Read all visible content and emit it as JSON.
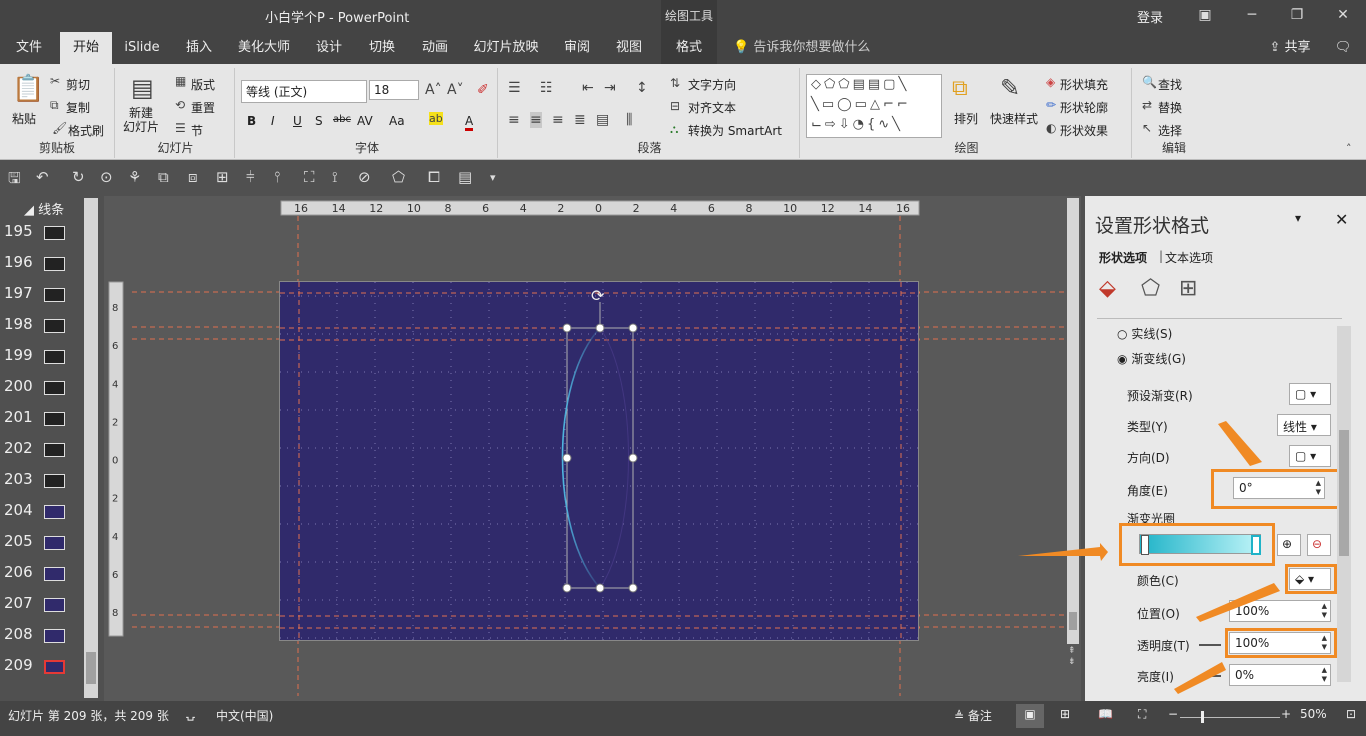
{
  "window": {
    "title": "小白学个P  -  PowerPoint",
    "context_group": "绘图工具",
    "login": "登录",
    "controls": [
      "restore-icon",
      "minimize-icon",
      "maximize-icon",
      "close-icon"
    ]
  },
  "tabs": {
    "items": [
      "文件",
      "开始",
      "iSlide",
      "插入",
      "美化大师",
      "设计",
      "切换",
      "动画",
      "幻灯片放映",
      "审阅",
      "视图",
      "格式"
    ],
    "active": "开始",
    "tell_me": "告诉我你想要做什么",
    "share": "共享"
  },
  "ribbon": {
    "clipboard": {
      "paste": "粘贴",
      "cut": "剪切",
      "copy": "复制",
      "format_painter": "格式刷",
      "label": "剪贴板"
    },
    "slides": {
      "new_slide": "新建\n幻灯片",
      "layout": "版式",
      "reset": "重置",
      "section": "节",
      "label": "幻灯片"
    },
    "font": {
      "name": "等线 (正文)",
      "size": "18",
      "label": "字体",
      "buttons": [
        "B",
        "I",
        "U",
        "S",
        "abc",
        "AV",
        "Aa",
        "A"
      ]
    },
    "paragraph": {
      "text_direction": "文字方向",
      "align_text": "对齐文本",
      "convert_smartart": "转换为 SmartArt",
      "label": "段落"
    },
    "drawing": {
      "arrange": "排列",
      "quick_styles": "快速样式",
      "shape_fill": "形状填充",
      "shape_outline": "形状轮廓",
      "shape_effects": "形状效果",
      "label": "绘图"
    },
    "editing": {
      "find": "查找",
      "replace": "替换",
      "select": "选择",
      "label": "编辑"
    }
  },
  "slides_panel": {
    "section": "线条",
    "numbers": [
      "195",
      "196",
      "197",
      "198",
      "199",
      "200",
      "201",
      "202",
      "203",
      "204",
      "205",
      "206",
      "207",
      "208",
      "209"
    ],
    "selected": "209"
  },
  "rulers": {
    "h_ticks": [
      "16",
      "14",
      "12",
      "10",
      "8",
      "6",
      "4",
      "2",
      "0",
      "2",
      "4",
      "6",
      "8",
      "10",
      "12",
      "14",
      "16"
    ],
    "v_ticks": [
      "8",
      "6",
      "4",
      "2",
      "0",
      "2",
      "4",
      "6",
      "8"
    ]
  },
  "pane": {
    "title": "设置形状格式",
    "tabs": [
      "形状选项",
      "文本选项"
    ],
    "solid_line": "实线(S)",
    "gradient_line": "渐变线(G)",
    "preset_gradient": "预设渐变(R)",
    "type_label": "类型(Y)",
    "type_value": "线性",
    "direction_label": "方向(D)",
    "angle_label": "角度(E)",
    "angle_value": "0°",
    "gradient_stops": "渐变光圈",
    "color_label": "颜色(C)",
    "position_label": "位置(O)",
    "position_value": "100%",
    "transparency_label": "透明度(T)",
    "transparency_value": "100%",
    "brightness_label": "亮度(I)",
    "brightness_value": "0%",
    "gradient_colors": [
      "#1fb3c8",
      "#bff4f8"
    ]
  },
  "status": {
    "slide_info": "幻灯片 第 209 张，共 209 张",
    "language": "中文(中国)",
    "notes": "备注",
    "zoom": "50%"
  },
  "colors": {
    "slide_bg": "#302a6b",
    "guide": "#e07050",
    "accent": "#f08a24",
    "curve": "#4fb6e0"
  }
}
